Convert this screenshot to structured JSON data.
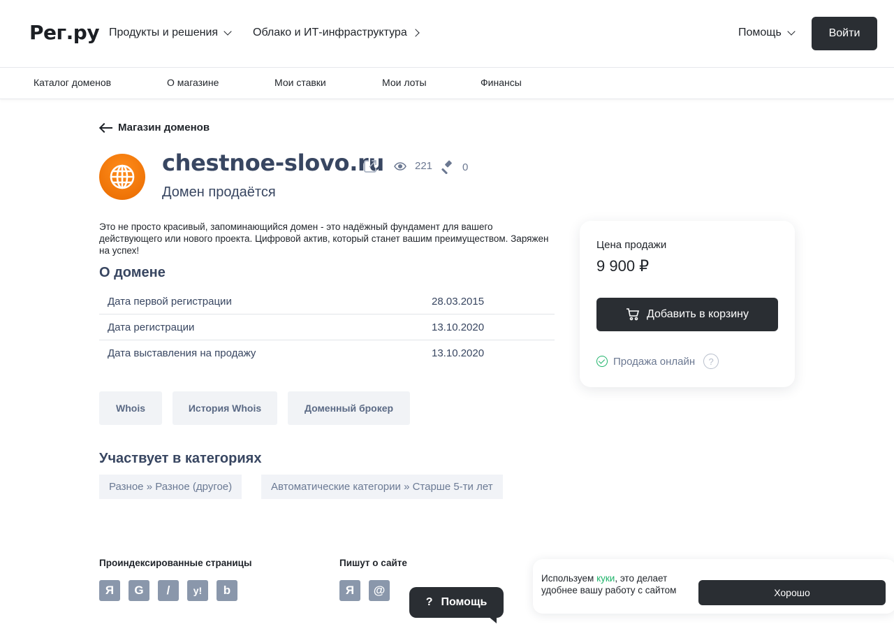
{
  "header": {
    "logo": "Рег.ру",
    "nav": [
      {
        "label": "Продукты и решения"
      },
      {
        "label": "Облако и ИТ-инфраструктура"
      }
    ],
    "help_label": "Помощь",
    "login_label": "Войти"
  },
  "subnav": [
    "Каталог доменов",
    "О магазине",
    "Мои ставки",
    "Мои лоты",
    "Финансы"
  ],
  "back_label": "Магазин доменов",
  "domain": {
    "name": "chestnoe-slovo.ru",
    "views": "221",
    "bids": "0",
    "status": "Домен продаётся",
    "description": "Это не просто красивый, запоминающийся домен - это надёжный фундамент для вашего действующего или нового проекта. Цифровой актив, который станет вашим преимуществом. Заряжен на успех!"
  },
  "about": {
    "title": "О домене",
    "rows": [
      {
        "label": "Дата первой регистрации",
        "value": "28.03.2015"
      },
      {
        "label": "Дата регистрации",
        "value": "13.10.2020"
      },
      {
        "label": "Дата выставления на продажу",
        "value": "13.10.2020"
      }
    ]
  },
  "tools": [
    "Whois",
    "История Whois",
    "Доменный брокер"
  ],
  "categories": {
    "title": "Участвует в категориях",
    "items": [
      "Разное » Разное (другое)",
      "Автоматические категории » Старше 5-ти лет"
    ]
  },
  "price_card": {
    "label": "Цена продажи",
    "price": "9 900 ₽",
    "cart_label": "Добавить в корзину",
    "online_label": "Продажа онлайн",
    "help_glyph": "?"
  },
  "footer": {
    "indexed_title": "Проиндексированные страницы",
    "indexed_engines": [
      "Я",
      "G",
      "/",
      "y!",
      "b"
    ],
    "mentions_title": "Пишут о сайте",
    "mentions_engines": [
      "Я",
      "@"
    ]
  },
  "help_bubble": {
    "glyph": "?",
    "label": "Помощь"
  },
  "cookie": {
    "text_before": "Используем ",
    "link": "куки",
    "text_after": ", это делает удобнее вашу работу с сайтом",
    "button": "Хорошо"
  },
  "colors": {
    "dark_button": "#2a2e33",
    "title_color": "#384661",
    "accent_green": "#1fb36a",
    "globe_orange": "#ff8c1a"
  }
}
